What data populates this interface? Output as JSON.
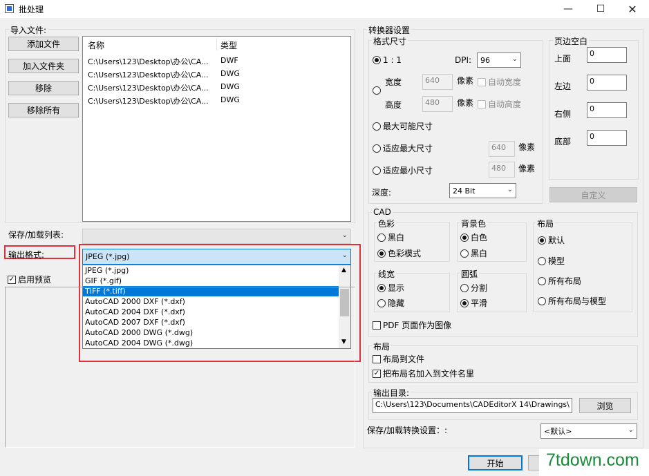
{
  "window": {
    "title": "批处理",
    "min_icon": "minimize-icon",
    "max_icon": "maximize-icon",
    "close_icon": "close-icon"
  },
  "import": {
    "group_label": "导入文件:",
    "add_file": "添加文件",
    "add_folder": "加入文件夹",
    "remove": "移除",
    "remove_all": "移除所有",
    "columns": [
      "名称",
      "类型"
    ],
    "rows": [
      {
        "name": "C:\\Users\\123\\Desktop\\办公\\CA...",
        "type": "DWF"
      },
      {
        "name": "C:\\Users\\123\\Desktop\\办公\\CA...",
        "type": "DWG"
      },
      {
        "name": "C:\\Users\\123\\Desktop\\办公\\CA...",
        "type": "DWG"
      },
      {
        "name": "C:\\Users\\123\\Desktop\\办公\\CA...",
        "type": "DWG"
      }
    ]
  },
  "save_list": {
    "label": "保存/加载列表:",
    "value": ""
  },
  "output_format": {
    "label": "输出格式:",
    "selected": "JPEG (*.jpg)",
    "options": [
      "JPEG (*.jpg)",
      "GIF (*.gif)",
      "TIFF (*.tiff)",
      "AutoCAD 2000 DXF (*.dxf)",
      "AutoCAD 2004 DXF (*.dxf)",
      "AutoCAD 2007 DXF (*.dxf)",
      "AutoCAD 2000 DWG (*.dwg)",
      "AutoCAD 2004 DWG (*.dwg)"
    ],
    "highlighted": "TIFF (*.tiff)"
  },
  "preview": {
    "label": "启用预览",
    "checked": true
  },
  "converter": {
    "group_label": "转换器设置",
    "format_size": {
      "label": "格式尺寸",
      "ratio_label": "1 : 1",
      "dpi_label": "DPI:",
      "dpi_value": "96",
      "width_label": "宽度",
      "width_value": "640",
      "width_unit": "像素",
      "auto_width": "自动宽度",
      "height_label": "高度",
      "height_value": "480",
      "height_unit": "像素",
      "auto_height": "自动高度",
      "max_size": "最大可能尺寸",
      "fit_max": "适应最大尺寸",
      "fit_max_value": "640",
      "fit_max_unit": "像素",
      "fit_min": "适应最小尺寸",
      "fit_min_value": "480",
      "fit_min_unit": "像素",
      "depth_label": "深度:",
      "depth_value": "24 Bit"
    },
    "margins": {
      "label": "页边空白",
      "top_label": "上面",
      "top_value": "0",
      "left_label": "左边",
      "left_value": "0",
      "right_label": "右侧",
      "right_value": "0",
      "bottom_label": "底部",
      "bottom_value": "0",
      "custom": "自定义"
    },
    "cad": {
      "label": "CAD",
      "color_label": "色彩",
      "bw": "黑白",
      "color_mode": "色彩模式",
      "bg_label": "背景色",
      "white": "白色",
      "black": "黑白",
      "layout_label": "布局",
      "default": "默认",
      "model": "模型",
      "all_layouts": "所有布局",
      "all_layouts_model": "所有布局与模型",
      "lw_label": "线宽",
      "show": "显示",
      "hide": "隐藏",
      "arc_label": "圆弧",
      "split": "分割",
      "smooth": "平滑",
      "pdf_as_image": "PDF 页面作为图像"
    },
    "layout": {
      "label": "布局",
      "to_file": "布局到文件",
      "name_in_file": "把布局名加入到文件名里"
    },
    "output_dir": {
      "label": "输出目录:",
      "value": "C:\\Users\\123\\Documents\\CADEditorX 14\\Drawings\\",
      "browse": "浏览"
    },
    "save_settings": {
      "label": "保存/加载转换设置：:",
      "value": "<默认>"
    }
  },
  "footer": {
    "start": "开始",
    "watermark": "7tdown.com"
  }
}
